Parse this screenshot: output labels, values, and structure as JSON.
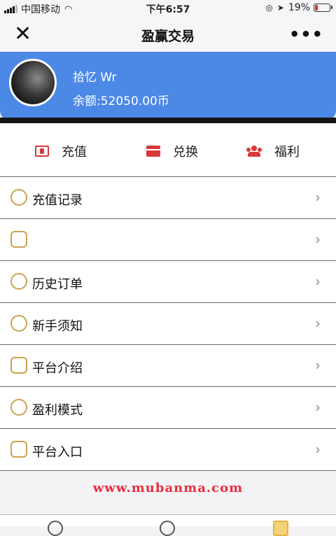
{
  "status_bar": {
    "carrier": "中国移动",
    "time": "下午6:57",
    "battery": "19%"
  },
  "nav": {
    "title": "盈赢交易",
    "close_icon": "close-icon",
    "more_icon": "more-icon"
  },
  "profile": {
    "name": "拾忆 Wr",
    "balance": "余额:52050.00币"
  },
  "quick_actions": [
    {
      "label": "充值",
      "icon": "recharge-icon"
    },
    {
      "label": "兑换",
      "icon": "card-icon"
    },
    {
      "label": "福利",
      "icon": "group-icon"
    }
  ],
  "menu": [
    {
      "label": "充值记录",
      "icon": "money-bag-icon"
    },
    {
      "label": "",
      "icon": "coin-icon"
    },
    {
      "label": "历史订单",
      "icon": "order-history-icon"
    },
    {
      "label": "新手须知",
      "icon": "guide-icon"
    },
    {
      "label": "平台介绍",
      "icon": "intro-icon"
    },
    {
      "label": "盈利模式",
      "icon": "profit-icon"
    },
    {
      "label": "平台入口",
      "icon": "entrance-icon"
    }
  ],
  "watermark": "www.mubanma.com",
  "colors": {
    "accent_blue": "#4c88e6",
    "action_red": "#d8393a",
    "icon_gold": "#c9a24e",
    "watermark_red": "#ee2c3c"
  }
}
